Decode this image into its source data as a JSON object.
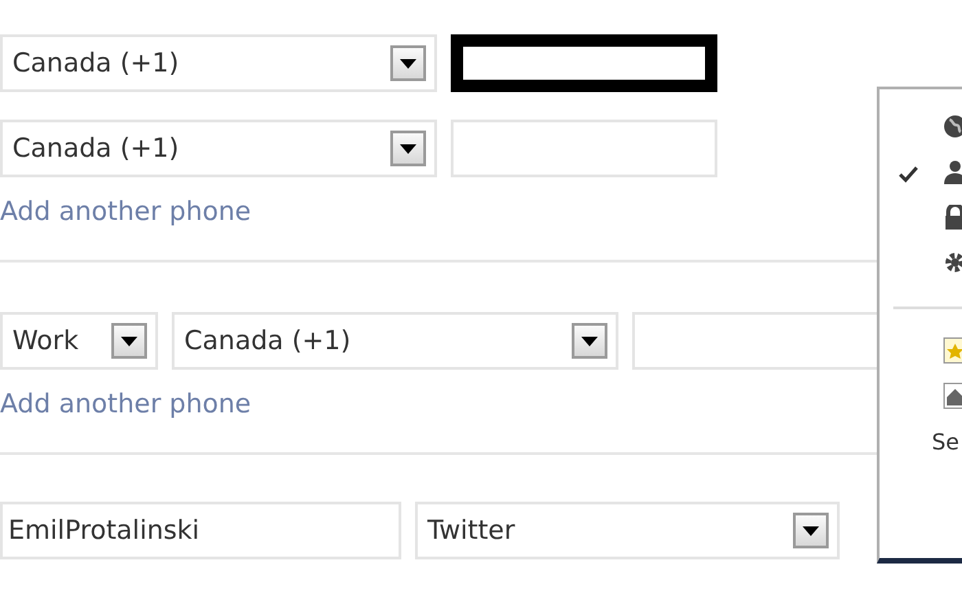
{
  "phone_section_1": {
    "rows": [
      {
        "country": "Canada (+1)",
        "focused": true
      },
      {
        "country": "Canada (+1)",
        "focused": false
      }
    ],
    "add_link": "Add another phone"
  },
  "phone_section_2": {
    "rows": [
      {
        "type": "Work",
        "country": "Canada (+1)"
      }
    ],
    "add_link": "Add another phone"
  },
  "screen_names": [
    {
      "value": "EmilProtalinski",
      "service": "Twitter"
    }
  ],
  "privacy_menu": {
    "items": [
      {
        "kind": "audience",
        "selected": false
      },
      {
        "kind": "audience",
        "selected": true
      },
      {
        "kind": "audience",
        "selected": false
      },
      {
        "kind": "audience",
        "selected": false
      },
      {
        "kind": "list"
      },
      {
        "kind": "list"
      },
      {
        "kind": "link",
        "label": "Se"
      }
    ]
  }
}
